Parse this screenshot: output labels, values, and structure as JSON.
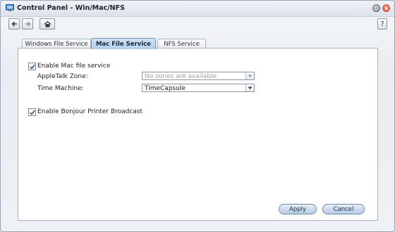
{
  "window": {
    "title": "Control Panel - Win/Mac/NFS"
  },
  "toolbar": {
    "back_icon": "arrow-left-icon",
    "forward_icon": "arrow-right-icon",
    "home_icon": "home-icon",
    "help_label": "?"
  },
  "tabs": [
    {
      "label": "Windows File Service",
      "active": false
    },
    {
      "label": "Mac File Service",
      "active": true
    },
    {
      "label": "NFS Service",
      "active": false
    }
  ],
  "mac": {
    "enable_label": "Enable Mac file service",
    "enable_checked": true,
    "appletalk_label": "AppleTalk Zone:",
    "appletalk_value": "No zones are available",
    "time_machine_label": "Time Machine:",
    "time_machine_value": "TimeCapsule",
    "bonjour_label": "Enable Bonjour Printer Broadcast",
    "bonjour_checked": true
  },
  "buttons": {
    "apply": "Apply",
    "cancel": "Cancel"
  },
  "colors": {
    "accent": "#b6cde9",
    "close": "#c4391f"
  }
}
